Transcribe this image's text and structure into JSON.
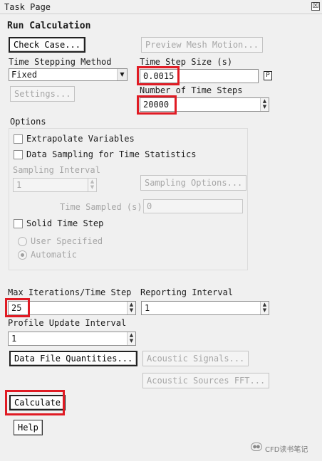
{
  "window": {
    "title": "Task Page",
    "close_glyph": "☒"
  },
  "run_calculation": {
    "heading": "Run Calculation",
    "check_case_label": "Check Case...",
    "preview_mesh_motion_label": "Preview Mesh Motion..."
  },
  "time_stepping": {
    "method_label": "Time Stepping Method",
    "method_value": "Fixed",
    "settings_label": "Settings...",
    "step_size_label": "Time Step Size (s)",
    "step_size_value": "0.0015",
    "param_label": "P",
    "num_steps_label": "Number of Time Steps",
    "num_steps_value": "20000"
  },
  "options": {
    "heading": "Options",
    "extrapolate_label": "Extrapolate Variables",
    "data_sampling_label": "Data Sampling for Time Statistics",
    "sampling_interval_label": "Sampling Interval",
    "sampling_interval_value": "1",
    "sampling_options_label": "Sampling Options...",
    "time_sampled_label": "Time Sampled (s)",
    "time_sampled_value": "0",
    "solid_time_step_label": "Solid Time Step",
    "user_specified_label": "User Specified",
    "automatic_label": "Automatic"
  },
  "iterations": {
    "max_iter_label": "Max Iterations/Time Step",
    "max_iter_value": "25",
    "reporting_label": "Reporting Interval",
    "reporting_value": "1",
    "profile_update_label": "Profile Update Interval",
    "profile_update_value": "1"
  },
  "actions": {
    "data_file_quantities_label": "Data File Quantities...",
    "acoustic_signals_label": "Acoustic Signals...",
    "acoustic_fft_label": "Acoustic Sources FFT...",
    "calculate_label": "Calculate",
    "help_label": "Help"
  },
  "watermark": {
    "text": "CFD读书笔记"
  },
  "colors": {
    "highlight": "#e01b24",
    "background": "#f0f0f0",
    "disabled_text": "#a6a6a6"
  },
  "icons": [
    "close-icon",
    "dropdown-arrow-icon",
    "spin-arrows-icon",
    "wechat-icon"
  ]
}
